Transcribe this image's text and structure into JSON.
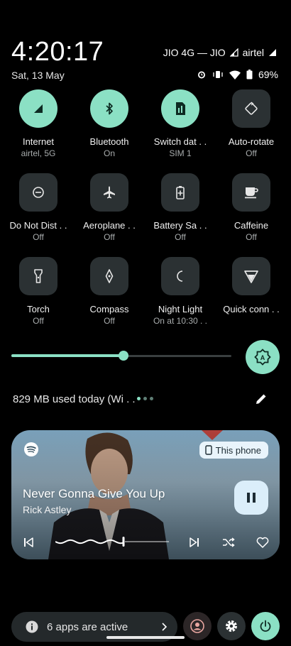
{
  "status": {
    "time": "4:20:17",
    "date": "Sat, 13 May",
    "carrier_text": "JIO 4G — JIO",
    "carrier2": "airtel",
    "battery": "69%"
  },
  "tiles": [
    {
      "label": "Internet",
      "sub": "airtel, 5G",
      "icon": "signal-icon",
      "state": "on"
    },
    {
      "label": "Bluetooth",
      "sub": "On",
      "icon": "bluetooth-icon",
      "state": "on"
    },
    {
      "label": "Switch dat . .",
      "sub": "SIM 1",
      "icon": "sim-icon",
      "state": "on"
    },
    {
      "label": "Auto-rotate",
      "sub": "Off",
      "icon": "rotate-icon",
      "state": "off"
    },
    {
      "label": "Do Not Dist . .",
      "sub": "Off",
      "icon": "do-not-disturb-icon",
      "state": "off"
    },
    {
      "label": "Aeroplane . .",
      "sub": "Off",
      "icon": "airplane-icon",
      "state": "off"
    },
    {
      "label": "Battery Sa . .",
      "sub": "Off",
      "icon": "battery-saver-icon",
      "state": "off"
    },
    {
      "label": "Caffeine",
      "sub": "Off",
      "icon": "coffee-cup-icon",
      "state": "off"
    },
    {
      "label": "Torch",
      "sub": "Off",
      "icon": "flashlight-icon",
      "state": "off"
    },
    {
      "label": "Compass",
      "sub": "Off",
      "icon": "compass-icon",
      "state": "off"
    },
    {
      "label": "Night Light",
      "sub": "On at 10:30 . .",
      "icon": "moon-icon",
      "state": "off"
    },
    {
      "label": "Quick conn . .",
      "sub": "",
      "icon": "quick-connect-icon",
      "state": "off"
    }
  ],
  "brightness": {
    "level": 0.51
  },
  "data_usage": "829 MB used today (Wi . .",
  "media": {
    "device": "This phone",
    "title": "Never Gonna Give You Up",
    "artist": "Rick Astley",
    "progress": 0.6
  },
  "footer": {
    "active_apps": "6 apps are active"
  },
  "colors": {
    "accent": "#8be0c4",
    "tile_off": "#2b3133"
  }
}
